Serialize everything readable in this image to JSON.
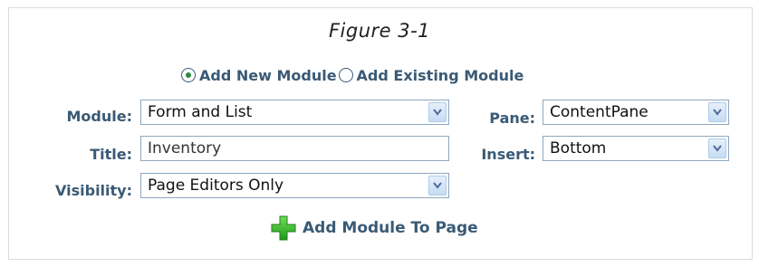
{
  "caption": "Figure 3-1",
  "mode": {
    "options": [
      {
        "label": "Add New Module",
        "selected": true
      },
      {
        "label": "Add Existing Module",
        "selected": false
      }
    ]
  },
  "form": {
    "module": {
      "label": "Module:",
      "value": "Form and List"
    },
    "title": {
      "label": "Title:",
      "value": "Inventory"
    },
    "visibility": {
      "label": "Visibility:",
      "value": "Page Editors Only"
    },
    "pane": {
      "label": "Pane:",
      "value": "ContentPane"
    },
    "insert": {
      "label": "Insert:",
      "value": "Bottom"
    }
  },
  "actions": {
    "add_module_label": "Add Module To Page"
  },
  "icons": {
    "dropdown": "chevron-down-icon",
    "add": "plus-icon",
    "add_color": "#2fb52a"
  }
}
